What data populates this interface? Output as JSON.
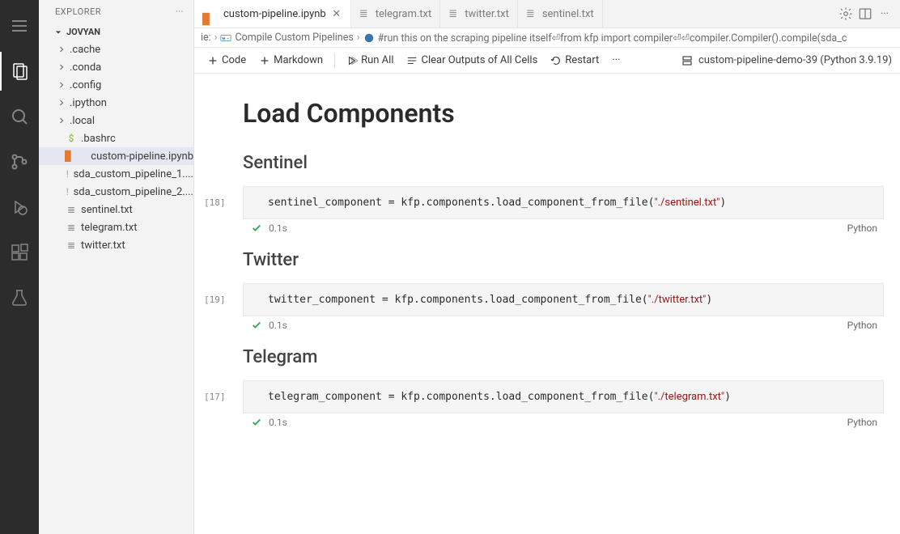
{
  "sidebar": {
    "title": "EXPLORER",
    "more": "···",
    "section": "JOVYAN",
    "items": [
      {
        "label": ".cache",
        "type": "folder"
      },
      {
        "label": ".conda",
        "type": "folder"
      },
      {
        "label": ".config",
        "type": "folder"
      },
      {
        "label": ".ipython",
        "type": "folder"
      },
      {
        "label": ".local",
        "type": "folder"
      },
      {
        "label": ".bashrc",
        "type": "bash"
      },
      {
        "label": "custom-pipeline.ipynb",
        "type": "notebook",
        "active": true
      },
      {
        "label": "sda_custom_pipeline_1....",
        "type": "yaml"
      },
      {
        "label": "sda_custom_pipeline_2....",
        "type": "yaml"
      },
      {
        "label": "sentinel.txt",
        "type": "txt"
      },
      {
        "label": "telegram.txt",
        "type": "txt"
      },
      {
        "label": "twitter.txt",
        "type": "txt"
      }
    ]
  },
  "tabs": [
    {
      "label": "custom-pipeline.ipynb",
      "icon": "notebook",
      "active": true
    },
    {
      "label": "telegram.txt",
      "icon": "txt"
    },
    {
      "label": "twitter.txt",
      "icon": "txt"
    },
    {
      "label": "sentinel.txt",
      "icon": "txt"
    }
  ],
  "breadcrumb": {
    "prefix": "ie:",
    "parts": [
      "Compile Custom Pipelines",
      "#run this on the scraping pipeline itself⏎from kfp import compiler⏎⏎compiler.Compiler().compile(sda_c"
    ]
  },
  "toolbar": {
    "code": "Code",
    "markdown": "Markdown",
    "runAll": "Run All",
    "clear": "Clear Outputs of All Cells",
    "restart": "Restart",
    "more": "···",
    "kernel": "custom-pipeline-demo-39 (Python 3.9.19)"
  },
  "notebook": {
    "h1": "Load Components",
    "sections": [
      {
        "title": "Sentinel",
        "idx": "[18]",
        "code_pre": "sentinel_component = kfp.components.load_component_from_file(",
        "code_str": "\"./sentinel.txt\"",
        "code_post": ")",
        "time": "0.1s",
        "lang": "Python"
      },
      {
        "title": "Twitter",
        "idx": "[19]",
        "code_pre": "twitter_component = kfp.components.load_component_from_file(",
        "code_str": "\"./twitter.txt\"",
        "code_post": ")",
        "time": "0.1s",
        "lang": "Python"
      },
      {
        "title": "Telegram",
        "idx": "[17]",
        "code_pre": "telegram_component = kfp.components.load_component_from_file(",
        "code_str": "\"./telegram.txt\"",
        "code_post": ")",
        "time": "0.1s",
        "lang": "Python"
      }
    ]
  }
}
